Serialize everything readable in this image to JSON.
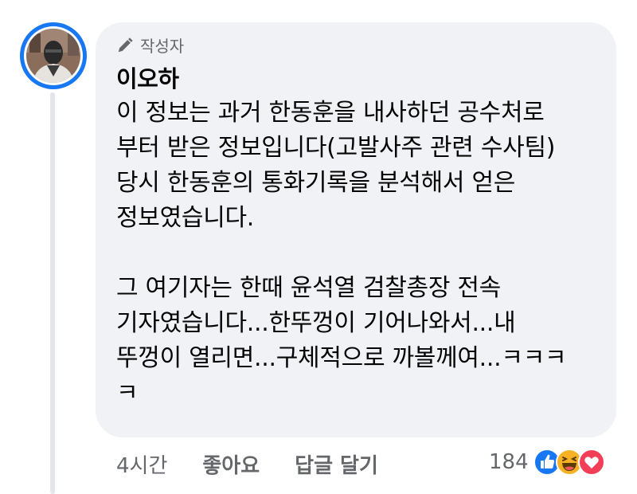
{
  "comment": {
    "author_badge": "작성자",
    "author_name": "이오하",
    "body_lines": [
      "이 정보는 과거 한동훈을 내사하던 공수처로",
      "부터 받은 정보입니다(고발사주 관련 수사팀)",
      "당시 한동훈의 통화기록을 분석해서 얻은",
      "정보였습니다.",
      "",
      "그 여기자는 한때 윤석열 검찰총장 전속",
      "기자였습니다...한뚜껑이 기어나와서...내",
      "뚜껑이 열리면...구체적으로 까볼께여...ㅋㅋㅋ",
      "ㅋ"
    ],
    "timestamp": "4시간",
    "like_label": "좋아요",
    "reply_label": "답글 달기",
    "reaction_count": "184",
    "reaction_icons": [
      "like-icon",
      "haha-icon",
      "love-icon"
    ]
  },
  "colors": {
    "accent": "#1877f2",
    "bubble": "#f0f2f5",
    "secondary_text": "#65676b",
    "love": "#f33e58",
    "haha": "#f7b125"
  }
}
